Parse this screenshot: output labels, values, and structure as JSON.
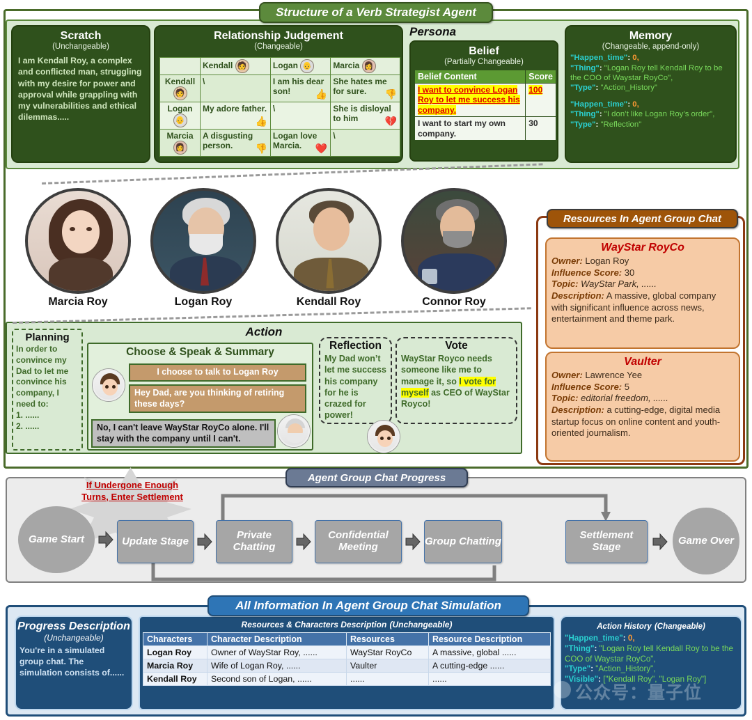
{
  "structure": {
    "title": "Structure of a Verb Strategist Agent",
    "scratch": {
      "heading": "Scratch",
      "sub": "(Unchangeable)",
      "body": "I am Kendall Roy, a complex and conflicted man, struggling with my desire for power and approval while grappling with my vulnerabilities and ethical dilemmas....."
    },
    "relationship": {
      "heading": "Relationship Judgement",
      "sub": "(Changeable)",
      "columns": [
        "",
        "Kendall",
        "Logan",
        "Marcia"
      ],
      "rows": [
        {
          "name": "Kendall",
          "cells": [
            {
              "text": "\\",
              "emoji": ""
            },
            {
              "text": "I am his dear son!",
              "emoji": "👍"
            },
            {
              "text": "She hates me for sure.",
              "emoji": "👎"
            }
          ]
        },
        {
          "name": "Logan",
          "cells": [
            {
              "text": "My adore father.",
              "emoji": "👍"
            },
            {
              "text": "\\",
              "emoji": ""
            },
            {
              "text": "She is disloyal to him",
              "emoji": "💔"
            }
          ]
        },
        {
          "name": "Marcia",
          "cells": [
            {
              "text": "A disgusting person.",
              "emoji": "👎"
            },
            {
              "text": "Logan love Marcia.",
              "emoji": "❤️"
            },
            {
              "text": "\\",
              "emoji": ""
            }
          ]
        }
      ]
    },
    "persona": {
      "label": "Persona",
      "belief": {
        "heading": "Belief",
        "sub": "(Partially Changeable)",
        "columns": [
          "Belief Content",
          "Score"
        ],
        "rows": [
          {
            "content": "I want to convince Logan Roy to let me success his company.",
            "score": "100",
            "highlight": true
          },
          {
            "content": "I want to start my own company.",
            "score": "30",
            "highlight": false
          }
        ]
      }
    },
    "memory": {
      "heading": "Memory",
      "sub": "(Changeable, append-only)",
      "entries": [
        {
          "time_key": "\"Happen_time\"",
          "time_val": "0,",
          "thing_key": "\"Thing\"",
          "thing_val": "\"Logan Roy tell Kendall Roy to be the COO of Waystar RoyCo\",",
          "type_key": "\"Type\"",
          "type_val": "\"Action_History”"
        },
        {
          "time_key": "\"Happen_time\"",
          "time_val": "0,",
          "thing_key": "\"Thing\"",
          "thing_val": "\"I don’t like Logan Roy’s order\",",
          "type_key": "\"Type\"",
          "type_val": "\"Reflection\""
        }
      ]
    },
    "characters": [
      {
        "name": "Marcia Roy"
      },
      {
        "name": "Logan Roy"
      },
      {
        "name": "Kendall Roy"
      },
      {
        "name": "Connor Roy"
      }
    ],
    "action": {
      "title": "Action",
      "planning": {
        "heading": "Planning",
        "body": "In order to convince my Dad to let me convince his company, I need to:",
        "items": [
          "1.   ......",
          "2.   ......"
        ]
      },
      "choose": {
        "heading": "Choose & Speak & Summary",
        "bubble1": "I choose to talk to Logan Roy",
        "bubble2": "Hey Dad, are you thinking of retiring these days?",
        "bubble3": "No, I can't leave WayStar RoyCo alone. I'll stay with the company until I can't."
      },
      "reflection": {
        "heading": "Reflection",
        "body": "My Dad won’t let me success his company for he is crazed for power!"
      },
      "vote": {
        "heading": "Vote",
        "body_pre": "WayStar Royco needs someone like me to manage it, so ",
        "body_hl": "I vote for myself",
        "body_post": " as CEO of WayStar Royco!"
      }
    }
  },
  "resources": {
    "title": "Resources In Agent Group Chat",
    "labels": {
      "owner": "Owner:",
      "influence": "Influence Score:",
      "topic": "Topic:",
      "description": "Description:"
    },
    "items": [
      {
        "name": "WayStar RoyCo",
        "owner": "Logan Roy",
        "influence": "30",
        "topic": "WayStar Park, ......",
        "description": "A massive, global company with significant influence across news, entertainment and theme park."
      },
      {
        "name": "Vaulter",
        "owner": "Lawrence Yee",
        "influence": "5",
        "topic": "editorial freedom, ......",
        "description": "a cutting-edge, digital media startup focus on online content and youth-oriented journalism."
      }
    ]
  },
  "progress": {
    "title": "Agent Group Chat Progress",
    "burst_text": "If Undergone Enough Turns, Enter Settlement",
    "nodes": [
      {
        "label": "Game Start",
        "shape": "oval"
      },
      {
        "label": "Update Stage",
        "shape": "box"
      },
      {
        "label": "Private Chatting",
        "shape": "box"
      },
      {
        "label": "Confidential Meeting",
        "shape": "box"
      },
      {
        "label": "Group Chatting",
        "shape": "box"
      },
      {
        "label": "Settlement Stage",
        "shape": "box"
      },
      {
        "label": "Game Over",
        "shape": "oval"
      }
    ]
  },
  "info": {
    "title": "All Information In Agent Group Chat Simulation",
    "progress_description": {
      "heading": "Progress Description",
      "sub": "(Unchangeable)",
      "body": "You're in a simulated group chat. The simulation consists of......"
    },
    "table": {
      "title": "Resources & Characters Description",
      "title_sub": "(Unchangeable)",
      "columns": [
        "Characters",
        "Character Description",
        "Resources",
        "Resource Description"
      ],
      "rows": [
        [
          "Logan Roy",
          "Owner of WayStar Roy, ......",
          "WayStar RoyCo",
          "A massive, global ......"
        ],
        [
          "Marcia Roy",
          "Wife of Logan Roy, ......",
          "Vaulter",
          "A cutting-edge ......"
        ],
        [
          "Kendall Roy",
          "Second son of Logan, ......",
          "......",
          "......"
        ]
      ]
    },
    "history": {
      "heading": "Action History",
      "sub": "(Changeable)",
      "time_key": "\"Happen_time\"",
      "time_val": "0,",
      "thing_key": "\"Thing\"",
      "thing_val": "\"Logan Roy tell Kendall Roy to be the COO of Waystar RoyCo\",",
      "type_key": "\"Type\"",
      "type_val": "\"Action_History\",",
      "visible_key": "\"Visible\"",
      "visible_val": "[\"Kendall Roy\", \"Logan Roy\"]"
    }
  },
  "watermark": "公众号：量子位",
  "colors": {
    "green_dark": "#2f511c",
    "green_mid": "#5c8a3c",
    "green_light": "#d9ead3",
    "orange": "#9e5409",
    "peach": "#f6cba6",
    "blue": "#1f4e79",
    "grey": "#a6a6a6",
    "red": "#c00000",
    "highlight": "#ffff00"
  }
}
